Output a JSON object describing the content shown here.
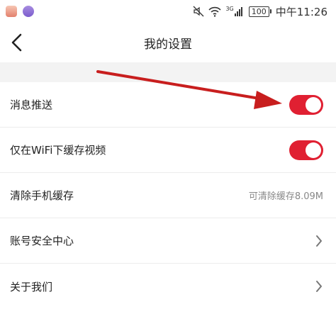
{
  "status_bar": {
    "battery": "100",
    "network": "3G",
    "time": "中午11:26"
  },
  "header": {
    "title": "我的设置"
  },
  "settings": [
    {
      "label": "消息推送",
      "control": "toggle",
      "on": true
    },
    {
      "label": "仅在WiFi下缓存视频",
      "control": "toggle",
      "on": true
    },
    {
      "label": "清除手机缓存",
      "control": "value",
      "value": "可清除缓存8.09M"
    },
    {
      "label": "账号安全中心",
      "control": "chevron"
    },
    {
      "label": "关于我们",
      "control": "chevron"
    }
  ],
  "colors": {
    "accent": "#e02032",
    "annotation_arrow": "#c81e1e",
    "section_gap": "#f3f3f3"
  },
  "icons": {
    "back": "chevron-left-icon",
    "mute": "mute-icon",
    "wifi": "wifi-icon",
    "signal": "signal-icon",
    "battery": "battery-icon"
  }
}
